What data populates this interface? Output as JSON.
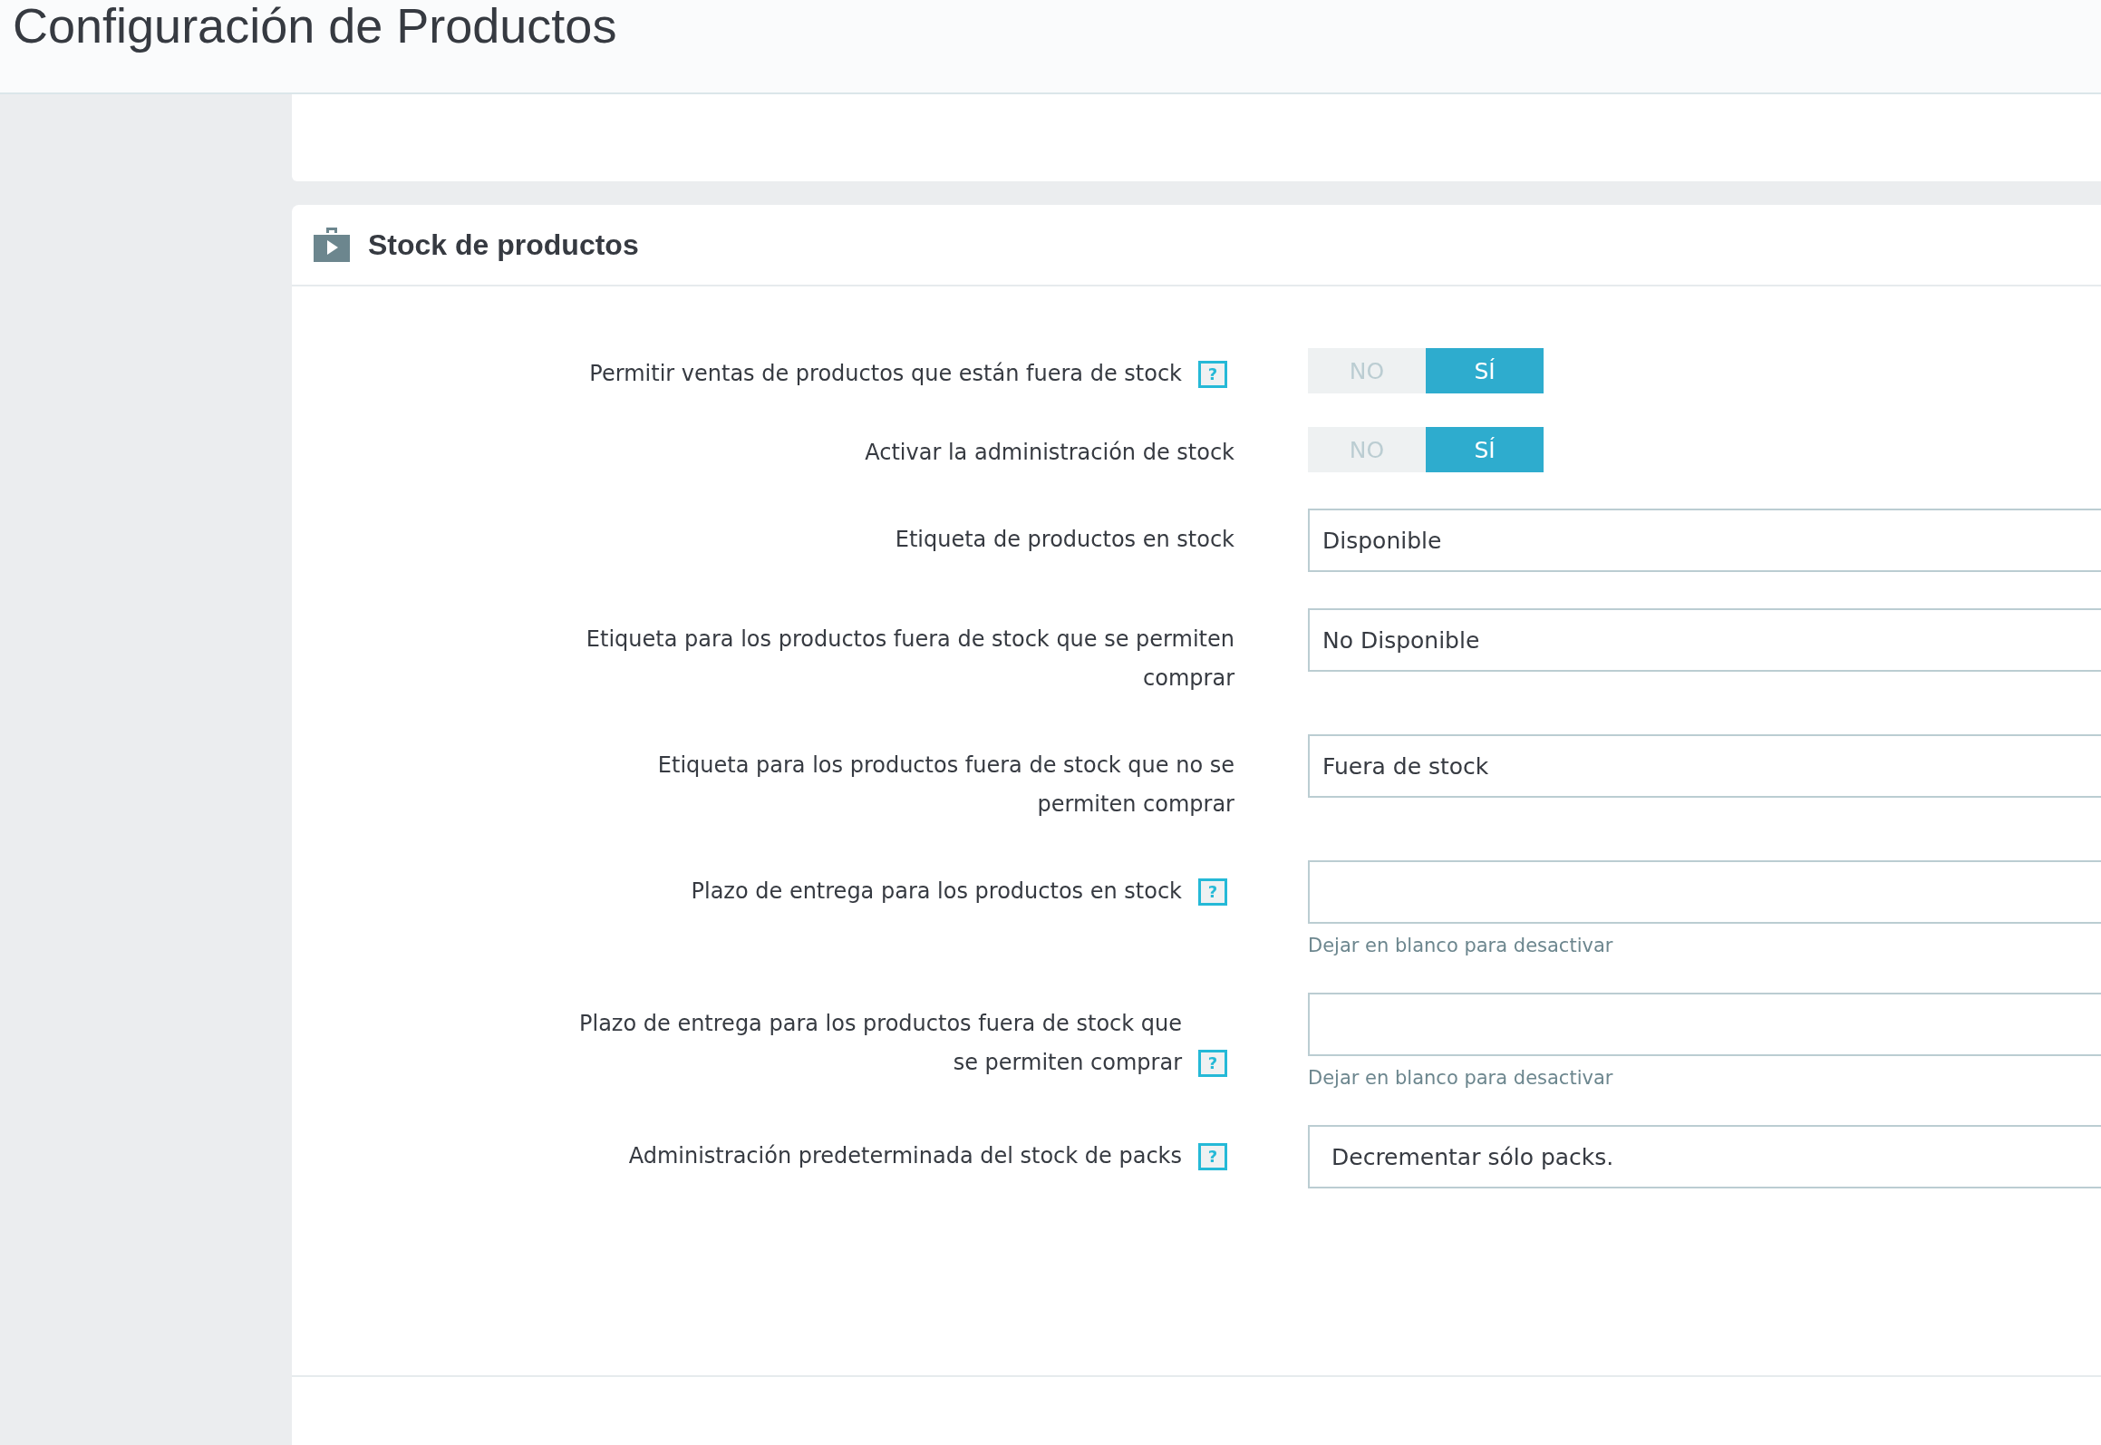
{
  "page_title": "Configuración de Productos",
  "panel": {
    "title": "Stock de productos",
    "fields": [
      {
        "kind": "toggle",
        "label": "Permitir ventas de productos que están fuera de stock",
        "help": "?",
        "options": [
          {
            "label": "NO",
            "selected": false
          },
          {
            "label": "SÍ",
            "selected": true
          }
        ]
      },
      {
        "kind": "toggle",
        "label": "Activar la administración de stock",
        "options": [
          {
            "label": "NO",
            "selected": false
          },
          {
            "label": "SÍ",
            "selected": true
          }
        ]
      },
      {
        "kind": "text",
        "label": "Etiqueta de productos en stock",
        "value": "Disponible"
      },
      {
        "kind": "text",
        "label": "Etiqueta para los productos fuera de stock que se permiten comprar",
        "value": "No Disponible"
      },
      {
        "kind": "text",
        "label": "Etiqueta para los productos fuera de stock que no se permiten comprar",
        "value": "Fuera de stock"
      },
      {
        "kind": "text",
        "label": "Plazo de entrega para los productos en stock",
        "help": "?",
        "hint": "Dejar en blanco para desactivar"
      },
      {
        "kind": "text",
        "label": "Plazo de entrega para los productos fuera de stock que se permiten comprar",
        "help": "?",
        "hint": "Dejar en blanco para desactivar"
      },
      {
        "kind": "select",
        "label": "Administración predeterminada del stock de packs",
        "help": "?",
        "value": "Decrementar sólo packs."
      }
    ]
  }
}
